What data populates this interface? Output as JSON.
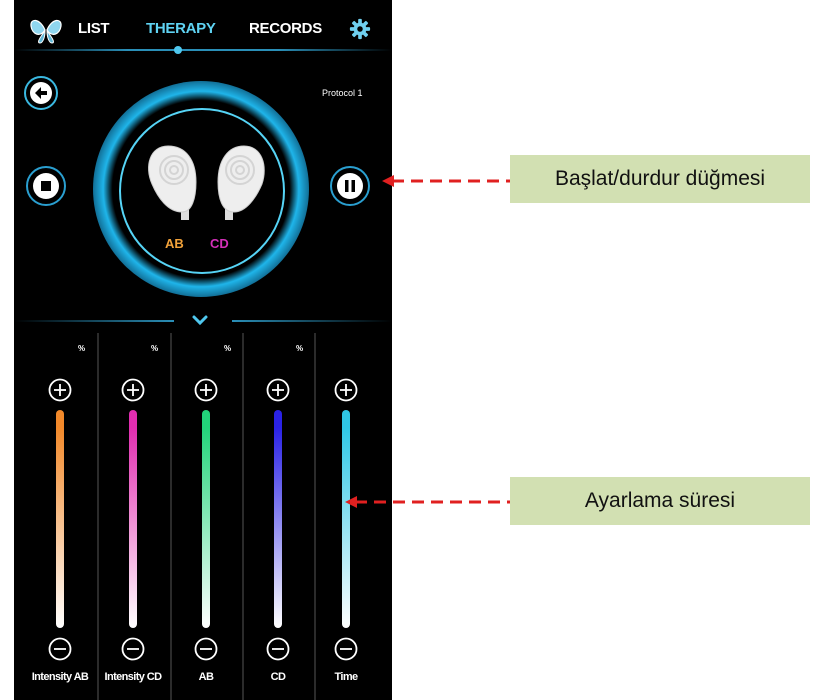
{
  "nav": {
    "tabs": [
      "LIST",
      "THERAPY",
      "RECORDS"
    ],
    "active_tab": "THERAPY",
    "icons": {
      "logo": "butterfly-logo-icon",
      "settings": "gear-icon"
    }
  },
  "protocol_label": "Protocol 1",
  "electrodes": {
    "ab_label": "AB",
    "cd_label": "CD"
  },
  "sliders": [
    {
      "label": "Intensity AB",
      "unit": "%",
      "color_top": "#f2892a",
      "color_bottom": "#ffffff"
    },
    {
      "label": "Intensity CD",
      "unit": "%",
      "color_top": "#e12db0",
      "color_bottom": "#ffffff"
    },
    {
      "label": "AB",
      "unit": "%",
      "color_top": "#22d47a",
      "color_bottom": "#ffffff"
    },
    {
      "label": "CD",
      "unit": "%",
      "color_top": "#2a22e6",
      "color_bottom": "#ffffff"
    },
    {
      "label": "Time",
      "unit": "",
      "color_top": "#2fc7e6",
      "color_bottom": "#ffffff"
    }
  ],
  "annotations": {
    "start_stop": "Başlat/durdur düğmesi",
    "time_adjust": "Ayarlama süresi"
  },
  "colors": {
    "accent": "#3ab8e0",
    "annotation_bg": "#d2e0b2",
    "annotation_arrow": "#e02020"
  }
}
